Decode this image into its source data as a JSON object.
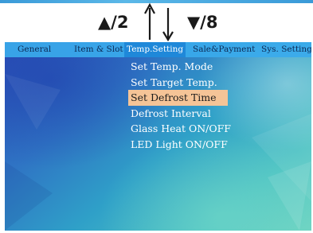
{
  "hints": {
    "up": "▲/2",
    "down": "▼/8"
  },
  "tabs": [
    {
      "label": "General",
      "active": false
    },
    {
      "label": "Item & Slot",
      "active": false
    },
    {
      "label": "Temp.Setting",
      "active": true
    },
    {
      "label": "Sale&Payment",
      "active": false
    },
    {
      "label": "Sys. Setting",
      "active": false
    }
  ],
  "menu": {
    "selected_index": 2,
    "items": [
      "Set Temp. Mode",
      "Set Target Temp.",
      "Set Defrost Time",
      "Defrost Interval",
      "Glass Heat ON/OFF",
      "LED Light ON/OFF"
    ]
  },
  "colors": {
    "tab_bar": "#3aaaeb",
    "active_tab": "#1f88d9",
    "selection_highlight": "#f5c497"
  }
}
